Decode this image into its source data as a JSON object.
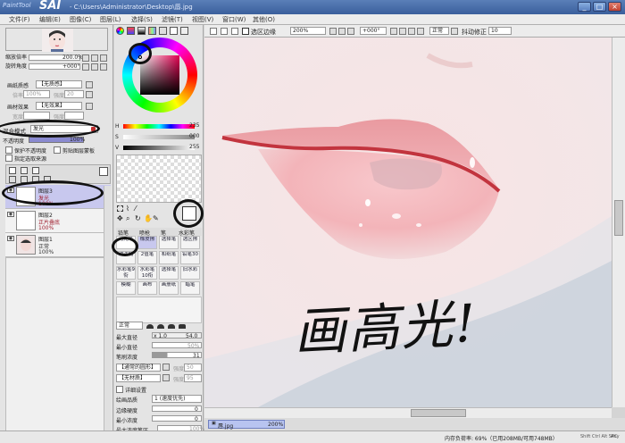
{
  "title": {
    "logo": "PaintTool",
    "app": "SAI",
    "path": "- C:\\Users\\Administrator\\Desktop\\唇.jpg"
  },
  "menu": [
    "文件(F)",
    "编辑(E)",
    "图像(C)",
    "图层(L)",
    "选择(S)",
    "滤镜(T)",
    "视图(V)",
    "窗口(W)",
    "其他(O)"
  ],
  "window_controls": {
    "minimize": "_",
    "maximize": "□",
    "close": "×"
  },
  "navigator": {
    "zoom_label": "缩放倍率",
    "zoom_value": "200.0%",
    "rotate_label": "旋转角度",
    "rotate_value": "+000°",
    "paper_label": "画纸质感",
    "paper_value": "【无质感】",
    "paper_scale": "倍率",
    "paper_scale_value": "100%",
    "paper_strength": "强度",
    "paper_strength_value": "20",
    "effect_label": "画材效果",
    "effect_value": "【无效果】",
    "effect_scale": "宽度",
    "effect_strength": "强度"
  },
  "layer_props": {
    "blend_label": "混合模式",
    "blend_value": "发光",
    "opacity_label": "不透明度",
    "opacity_value": "100%",
    "protect_label": "保护不透明度",
    "clip_label": "剪贴图层蒙板",
    "select_source_label": "指定选取来源"
  },
  "layers": [
    {
      "name": "图层3",
      "mode": "发光",
      "opacity": "100%"
    },
    {
      "name": "图层2",
      "mode": "正片叠底",
      "opacity": "100%"
    },
    {
      "name": "图层1",
      "mode": "正常",
      "opacity": "100%"
    }
  ],
  "color_values": {
    "h": "235",
    "s": "000",
    "v": "255",
    "h_label": "H",
    "s_label": "S",
    "v_label": "V"
  },
  "tool_tabs": [
    "铅笔",
    "喷枪",
    "笔",
    "水彩笔"
  ],
  "tools": [
    [
      "马克笔",
      "橡皮擦",
      "选择笔",
      "选区擦"
    ],
    [
      "油漆桶",
      "2值笔",
      "和纸笔",
      "铅笔30"
    ],
    [
      "水彩笔9衔",
      "水彩笔10衔",
      "选择笔",
      "旧水彩"
    ],
    [
      "模糊",
      "画布",
      "画册纸",
      "蜡笔"
    ]
  ],
  "brush": {
    "mode": "正常",
    "max_diameter_label": "最大直径",
    "max_diameter_mult": "x 1.0",
    "max_diameter_value": "54.0",
    "min_diameter_label": "最小直径",
    "min_diameter_value": "50%",
    "density_label": "笔刷浓度",
    "density_value": "31",
    "shape_value": "【通常的圆形】",
    "shape_strength_label": "强度",
    "shape_strength_value": "50",
    "texture_value": "【无材质】",
    "texture_strength_label": "强度",
    "texture_strength_value": "95",
    "detail_label": "详细设置",
    "quality_label": "绘画品质",
    "quality_value": "1 (速度优先)",
    "edge_label": "边缘硬度",
    "edge_value": "0",
    "min_density_label": "最小浓度",
    "min_density_value": "0",
    "max_pressure_label": "最大浓度笔压",
    "max_pressure_value": "100%"
  },
  "canvas_toolbar": {
    "selection_edge": "选区边缘",
    "zoom": "200%",
    "rotate": "+000°",
    "mode": "正常",
    "stabilizer_label": "抖动修正",
    "stabilizer_value": "10"
  },
  "handwriting": "画高光!",
  "document_tab": {
    "name": "唇.jpg",
    "zoom": "200%"
  },
  "status": {
    "memory": "内存负荷率: 69%（已用208MB/可用748MB）",
    "keys": "Shift Ctrl Alt SPC",
    "extra": "Any"
  },
  "colors": {
    "accent": "#3a5f9c",
    "lip": "#d8606a",
    "layer_selected": "#c8c8ee",
    "red_text": "#a02030"
  }
}
